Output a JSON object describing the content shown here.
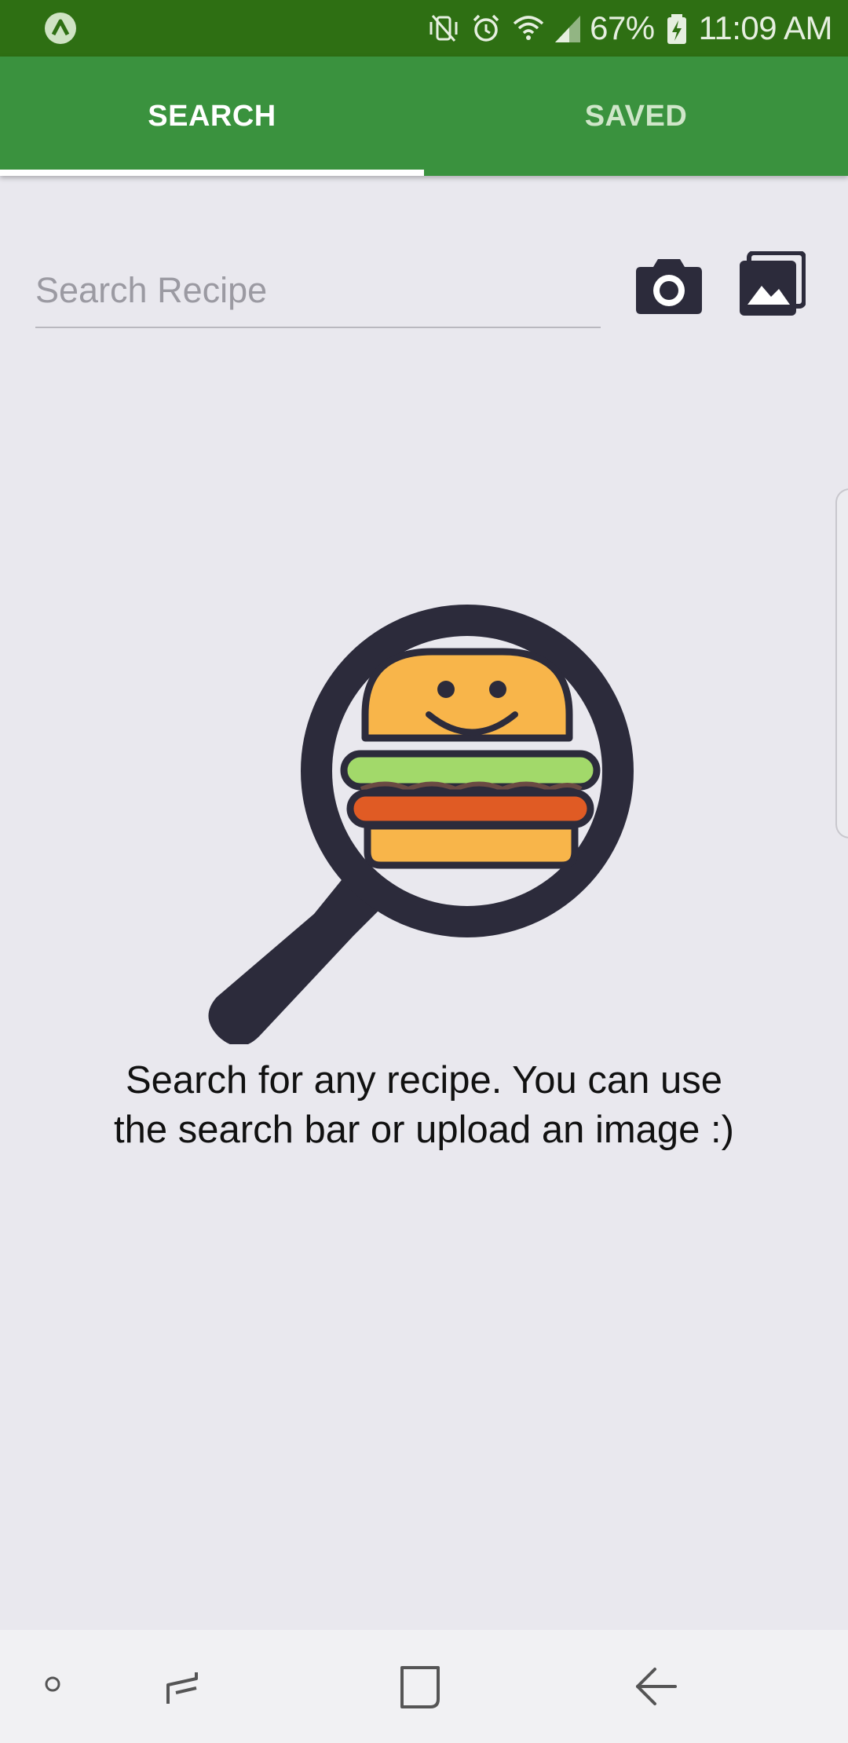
{
  "status_bar": {
    "battery_percent": "67%",
    "time": "11:09 AM",
    "icons": [
      "app-notification-icon",
      "vibrate-off-icon",
      "alarm-icon",
      "wifi-icon",
      "signal-icon",
      "battery-charging-icon"
    ]
  },
  "tabs": [
    {
      "label": "SEARCH",
      "selected": true
    },
    {
      "label": "SAVED",
      "selected": false
    }
  ],
  "search": {
    "placeholder": "Search Recipe",
    "value": ""
  },
  "actions": {
    "camera_icon": "camera-icon",
    "gallery_icon": "gallery-icon"
  },
  "empty_state": {
    "illustration": "burger-magnifier-illustration",
    "message": "Search for any recipe. You can use the search bar or upload an image :)"
  },
  "navigation_bar": {
    "icons": [
      "nav-dot-icon",
      "recents-icon",
      "home-icon",
      "back-icon"
    ]
  },
  "colors": {
    "status_bar": "#2e6f13",
    "tab_bar": "#3a923e",
    "background": "#e9e8ee",
    "icon_dark": "#2c2b3b",
    "burger_bun": "#f8b54a",
    "lettuce": "#a2d96a",
    "patty": "#e05b24"
  }
}
